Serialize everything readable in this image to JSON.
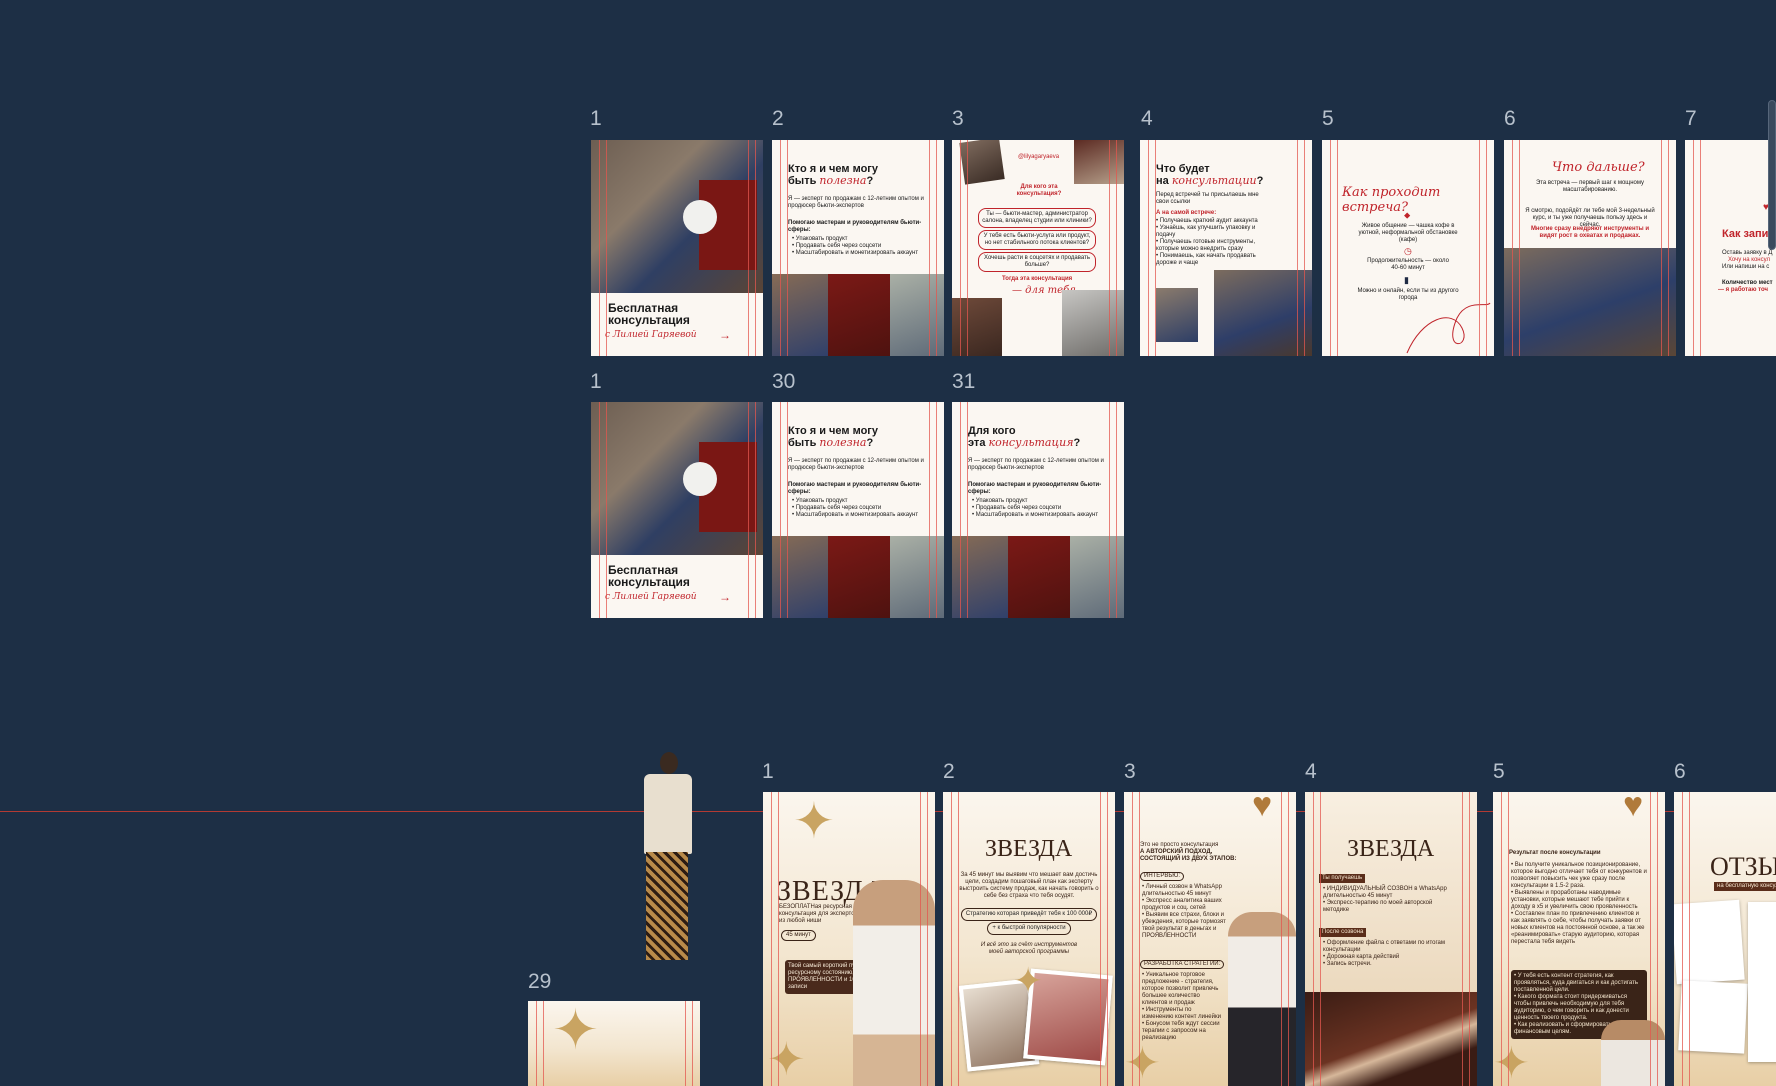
{
  "canvas": {
    "background": "#1d2f45",
    "guide_color": "#e3574f",
    "accent": "#c0242b",
    "gold": "#c9a462"
  },
  "row1": {
    "labels": [
      "1",
      "2",
      "3",
      "4",
      "5",
      "6",
      "7"
    ],
    "f1": {
      "title": "Бесплатная консультация",
      "author": "с Лилией Гаряевой"
    },
    "f2": {
      "title_a": "Кто я и чем могу",
      "title_b": "быть",
      "title_c": "полезна",
      "q": "?",
      "intro": "Я — эксперт по продажам с 12-летним опытом и продюсер бьюти-экспертов",
      "help": "Помогаю мастерам и руководителям бьюти-сферы:",
      "items": [
        "Упаковать продукт",
        "Продавать себя через соцсети",
        "Масштабировать и монетизировать аккаунт"
      ]
    },
    "f3": {
      "handle": "@lilyagaryaeva",
      "heading": "Для кого эта консультация?",
      "pills": [
        "Ты — бьюти-мастер, администратор салона, владелец студии или клиники?",
        "У тебя есть бьюти-услуга или продукт, но нет стабильного потока клиентов?",
        "Хочешь расти в соцсетях и продавать больше?"
      ],
      "then": "Тогда эта консультация",
      "for_you": "— для тебя"
    },
    "f4": {
      "title_a": "Что будет",
      "title_b": "на",
      "title_c": "консультации",
      "q": "?",
      "intro": "Перед встречей ты присылаешь мне свои ссылки",
      "sub": "А на самой встрече:",
      "items": [
        "Получаешь краткий аудит аккаунта",
        "Узнаёшь, как улучшить упаковку и подачу",
        "Получаешь готовые инструменты, которые можно внедрить сразу",
        "Понимаешь, как начать продавать дороже и чаще"
      ]
    },
    "f5": {
      "title": "Как проходит встреча?",
      "p1": "Живое общение — чашка кофе в уютной, неформальной обстановке (кафе)",
      "p2": "Продолжительность — около 40-60 минут",
      "p3": "Можно и онлайн, если ты из другого города"
    },
    "f6": {
      "title": "Что дальше?",
      "p1": "Эта встреча — первый шаг к мощному масштабированию.",
      "p2": "Я смотрю, подойдёт ли тебе мой 3-недельный курс, и ты уже получаешь пользу здесь и сейчас.",
      "p3": "Многие сразу внедряют инструменты и видят рост в охватах и продажах."
    },
    "f7": {
      "title": "Как запи",
      "p1": "Оставь заявку в Д",
      "p2": "Хочу на консул",
      "p3": "Или напиши на с",
      "p4": "Количество мест",
      "p5": "— я работаю точ"
    }
  },
  "row2": {
    "labels": [
      "1",
      "30",
      "31"
    ],
    "f1": {
      "title": "Бесплатная консультация",
      "author": "с Лилией Гаряевой"
    },
    "f30": {
      "title_a": "Кто я и чем могу",
      "title_b": "быть",
      "title_c": "полезна",
      "q": "?",
      "intro": "Я — эксперт по продажам с 12-летним опытом и продюсер бьюти-экспертов",
      "help": "Помогаю мастерам и руководителям бьюти-сферы:",
      "items": [
        "Упаковать продукт",
        "Продавать себя через соцсети",
        "Масштабировать и монетизировать аккаунт"
      ]
    },
    "f31": {
      "title_a": "Для кого",
      "title_b": "эта",
      "title_c": "консультация",
      "q": "?",
      "intro": "Я — эксперт по продажам с 12-летним опытом и продюсер бьюти-экспертов",
      "help": "Помогаю мастерам и руководителям бьюти-сферы:",
      "items": [
        "Упаковать продукт",
        "Продавать себя через соцсети",
        "Масштабировать и монетизировать аккаунт"
      ]
    }
  },
  "row3": {
    "labels": [
      "1",
      "2",
      "3",
      "4",
      "5",
      "6",
      "29"
    ],
    "f1": {
      "title": "ЗВЕЗДА",
      "sub": "БЕЗОПЛАТНая ресурсная консультация для экспертов из любой ниши",
      "badge": "45 минут",
      "note": "Твой самый короткий путь к ресурсному состоянию, ПРОЯВЛЕННОСТИ и 100% записи"
    },
    "f2": {
      "title": "ЗВЕЗДА",
      "p1": "За 45 минут мы выявим что мешает вам достичь цели, создадим пошаговый план как эксперту выстроить систему продаж, как начать говорить о себе без страха что тебя осудят.",
      "pill1": "Стратегию которая приведёт тебя к 100 000₽",
      "pill2": "+ к быстрой популярности",
      "p2": "И всё это за счёт инструментов моей авторской программы"
    },
    "f3": {
      "p0": "Это не просто консультация",
      "h": "А АВТОРСКИЙ ПОДХОД, СОСТОЯЩИЙ ИЗ ДВУХ ЭТАПОВ:",
      "tag1": "ИНТЕРВЬЮ:",
      "items1": [
        "Личный созвон в WhatsApp длительностью 45 минут",
        "Экспресс аналитика ваших продуктов и соц. сетей",
        "Выявим все страхи, блоки и убеждения, которые тормозят твой результат в деньгах и ПРОЯВЛЕННОСТИ"
      ],
      "tag2": "РАЗРАБОТКА СТРАТЕГИИ:",
      "items2": [
        "Уникальное торговое предложение - стратегия, которое позволит привлечь большее количество клиентов и продаж",
        "Инструменты по изменению контент линейки",
        "Бонусом тебя ждут сессии терапии с запросом на реализацию"
      ]
    },
    "f4": {
      "title": "ЗВЕЗДА",
      "tag1": "Ты получаешь",
      "items1": [
        "ИНДИВИДУАЛЬНЫЙ СОЗВОН в WhatsApp длительностью 45 минут",
        "Экспресс-терапию по моей авторской методике"
      ],
      "tag2": "После созвона",
      "items2": [
        "Оформление файла с ответами по итогам консультации",
        "Дорожная карта действий",
        "Запись встречи."
      ]
    },
    "f5": {
      "h": "Результат после консультации",
      "items": [
        "Вы получите уникальное позиционирование, которое выгодно отличает тебя от конкурентов и позволяет повысить чек уже сразу после консультации в 1.5-2 раза.",
        "Выявлены и проработаны наводимые установки, которые мешают тебе прийти к доходу в х5 и увеличить свою проявленность",
        "Составлен план по привлечению клиентов и как заявлять о себе, чтобы получать заявки от новых клиентов на постоянной основе, а так же «реанимировать» старую аудиторию, которая перестала тебя видеть"
      ],
      "box": [
        "У тебя есть контент стратегия, как проявляться, куда двигаться и как достигать поставленной цели.",
        "Какого формата стоит придерживаться чтобы привлечь необходимую для тебя аудиторию, о чем говорить и как донести ценность твоего продукта.",
        "Как реализовать и сформировать план по финансовым целям."
      ]
    },
    "f6": {
      "title": "ОТЗЫ",
      "sub": "на бесплатную консульт"
    }
  }
}
